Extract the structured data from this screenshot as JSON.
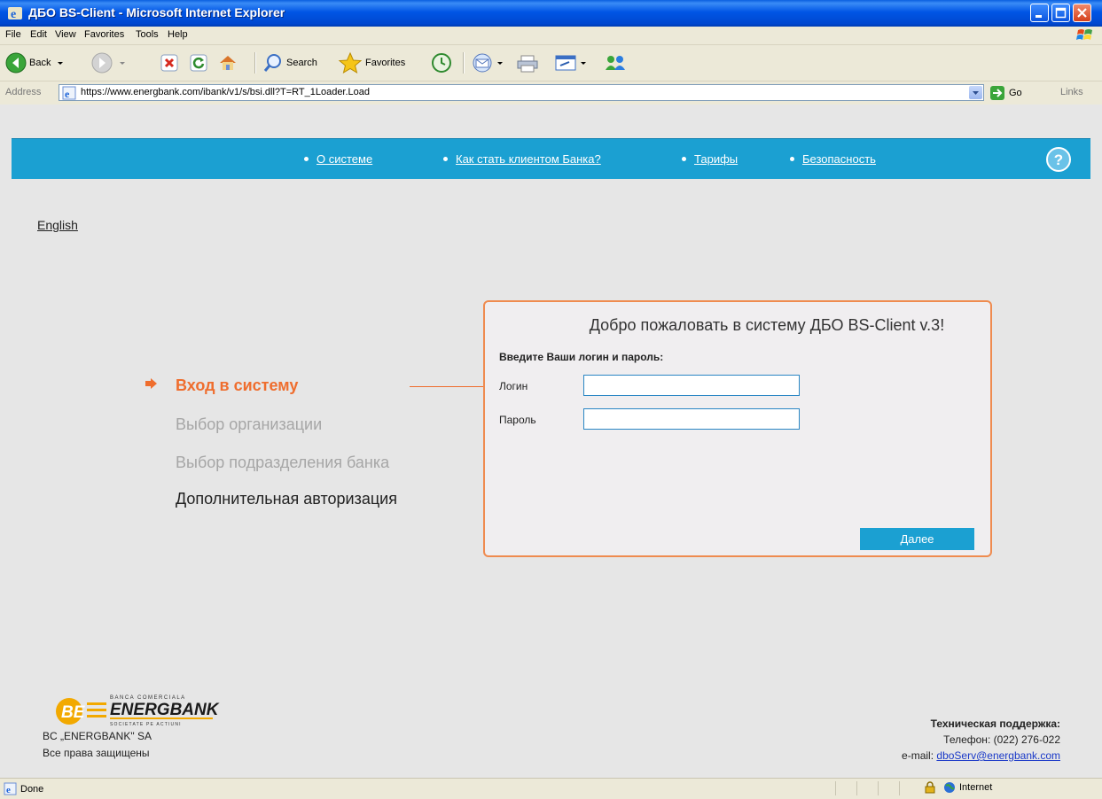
{
  "window": {
    "title": "ДБО BS-Client - Microsoft Internet Explorer"
  },
  "menu": [
    "File",
    "Edit",
    "View",
    "Favorites",
    "Tools",
    "Help"
  ],
  "toolbar": {
    "back_label": "Back",
    "search_label": "Search",
    "favorites_label": "Favorites"
  },
  "address": {
    "label": "Address",
    "url": "https://www.energbank.com/ibank/v1/s/bsi.dll?T=RT_1Loader.Load",
    "go_label": "Go",
    "links_label": "Links"
  },
  "nav": {
    "items": [
      "О системе",
      "Как стать клиентом Банка?",
      "Тарифы",
      "Безопасность"
    ]
  },
  "language_link": "English",
  "steps": [
    {
      "label": "Вход в систему",
      "state": "active"
    },
    {
      "label": "Выбор организации",
      "state": "disabled"
    },
    {
      "label": "Выбор подразделения банка",
      "state": "disabled"
    },
    {
      "label": "Дополнительная авторизация",
      "state": "normal"
    }
  ],
  "login": {
    "title": "Добро пожаловать в систему ДБО BS-Client v.3!",
    "instruction": "Введите Ваши логин и пароль:",
    "login_label": "Логин",
    "login_value": "",
    "password_label": "Пароль",
    "password_value": "",
    "next_label": "Далее"
  },
  "footer": {
    "logo_top": "BANCA COMERCIALA",
    "logo_name": "ENERGBANK",
    "logo_bottom": "SOCIETATE PE ACTIUNI",
    "company": "BC „ENERGBANK\" SA",
    "rights": "Все права защищены",
    "support_title": "Техническая поддержка:",
    "phone": "Телефон: (022) 276-022",
    "email_label": "e-mail:",
    "email": "dboServ@energbank.com"
  },
  "status": {
    "text": "Done",
    "zone": "Internet"
  },
  "colors": {
    "title_bar": "#0055e5",
    "nav_bar": "#1ba0d2",
    "accent_orange": "#ef6d2d",
    "page_bg": "#e6e6e6",
    "button_blue": "#1ba0d2"
  }
}
